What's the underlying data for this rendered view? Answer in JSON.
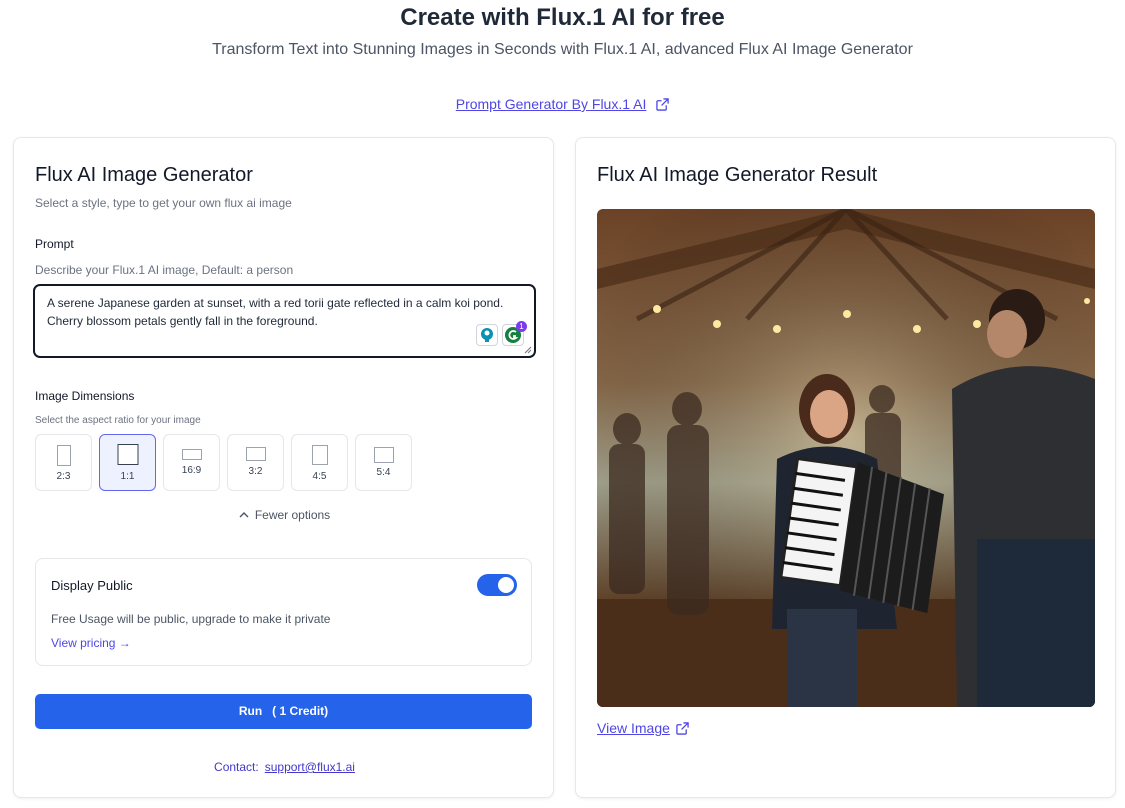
{
  "header": {
    "title": "Create with Flux.1 AI for free",
    "subtitle": "Transform Text into Stunning Images in Seconds with Flux.1 AI, advanced Flux AI Image Generator",
    "prompt_link": "Prompt Generator By Flux.1 AI"
  },
  "generator": {
    "title": "Flux AI Image Generator",
    "description": "Select a style, type to get your own flux ai image",
    "prompt_label": "Prompt",
    "prompt_hint": "Describe your Flux.1 AI image, Default: a person",
    "prompt_value": "A serene Japanese garden at sunset, with a red torii gate reflected in a calm koi pond. Cherry blossom petals gently fall in the foreground.",
    "extension_badge": "1",
    "dimensions_label": "Image Dimensions",
    "dimensions_hint": "Select the aspect ratio for your image",
    "ratios": [
      "2:3",
      "1:1",
      "16:9",
      "3:2",
      "4:5",
      "5:4"
    ],
    "selected_ratio": "1:1",
    "fewer_options": "Fewer options",
    "display_public": {
      "title": "Display Public",
      "enabled": true,
      "description": "Free Usage will be public, upgrade to make it private",
      "link": "View pricing →"
    },
    "run_label": "Run   ( 1 Credit)",
    "contact_label": "Contact:",
    "contact_email": "support@flux1.ai"
  },
  "result": {
    "title": "Flux AI Image Generator Result",
    "view_image": "View Image"
  },
  "colors": {
    "accent": "#2563eb",
    "link": "#4f46e5"
  }
}
